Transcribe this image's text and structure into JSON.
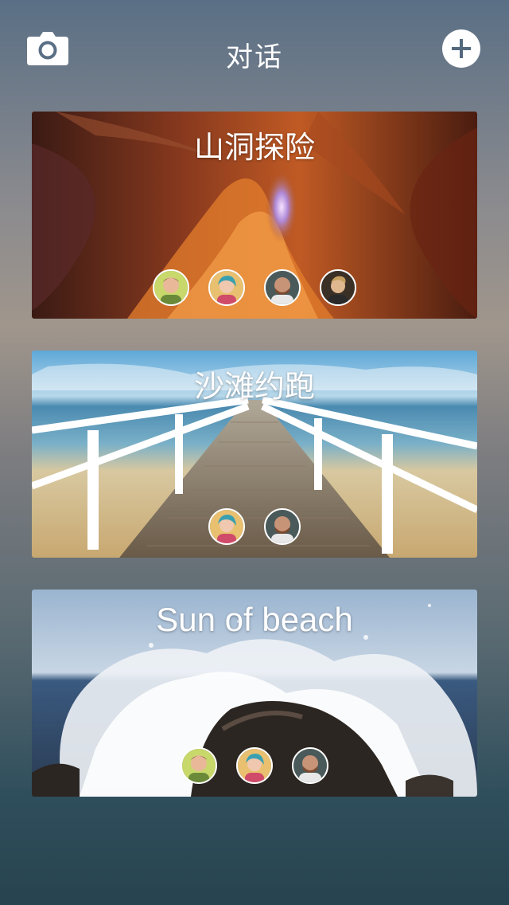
{
  "header": {
    "title": "对话",
    "left_icon": "camera-icon",
    "right_icon": "plus-icon"
  },
  "conversations": [
    {
      "title": "山洞探险",
      "scene": "canyon",
      "members": [
        "member-1",
        "member-2",
        "member-3",
        "member-4"
      ]
    },
    {
      "title": "沙滩约跑",
      "scene": "pier",
      "members": [
        "member-2",
        "member-3"
      ]
    },
    {
      "title": "Sun of beach",
      "scene": "waves",
      "members": [
        "member-1",
        "member-2",
        "member-3"
      ]
    }
  ],
  "colors": {
    "text": "#ffffff",
    "button": "#ffffff",
    "icon": "#54697e"
  }
}
